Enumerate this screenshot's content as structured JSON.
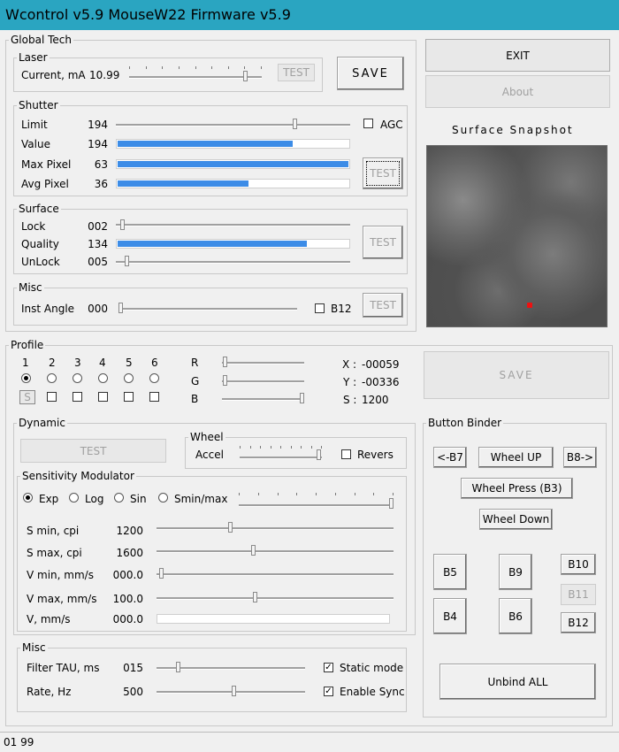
{
  "window": {
    "title": "Wcontrol v5.9  MouseW22  Firmware v5.9"
  },
  "global_tech": {
    "legend": "Global Tech",
    "laser": {
      "legend": "Laser",
      "label": "Current, mA",
      "value": "10.99",
      "test": "TEST"
    },
    "save": "SAVE",
    "shutter": {
      "legend": "Shutter",
      "rows": [
        {
          "label": "Limit",
          "value": "194"
        },
        {
          "label": "Value",
          "value": "194",
          "level": 0.76
        },
        {
          "label": "Max Pixel",
          "value": "63",
          "level": 1.0
        },
        {
          "label": "Avg Pixel",
          "value": "36",
          "level": 0.57
        }
      ],
      "agc": "AGC",
      "test": "TEST"
    },
    "surface": {
      "legend": "Surface",
      "rows": [
        {
          "label": "Lock",
          "value": "002"
        },
        {
          "label": "Quality",
          "value": "134",
          "level": 0.82
        },
        {
          "label": "UnLock",
          "value": "005"
        }
      ],
      "test": "TEST"
    },
    "misc": {
      "legend": "Misc",
      "label": "Inst Angle",
      "value": "000",
      "b12": "B12",
      "test": "TEST"
    }
  },
  "right": {
    "exit": "EXIT",
    "about": "About",
    "snapshot_title": "Surface Snapshot"
  },
  "profile": {
    "legend": "Profile",
    "numbers": [
      "1",
      "2",
      "3",
      "4",
      "5",
      "6"
    ],
    "s_button": "S",
    "rgb": [
      "R",
      "G",
      "B"
    ],
    "coords": {
      "x_label": "X :",
      "x": "-00059",
      "y_label": "Y :",
      "y": "-00336",
      "s_label": "S :",
      "s": "1200"
    },
    "save": "SAVE"
  },
  "dynamic": {
    "legend": "Dynamic",
    "test": "TEST",
    "wheel": {
      "legend": "Wheel",
      "accel": "Accel",
      "revers": "Revers"
    },
    "sensitivity": {
      "legend": "Sensitivity Modulator",
      "modes": [
        "Exp",
        "Log",
        "Sin",
        "Smin/max"
      ],
      "rows": [
        {
          "label": "S min, cpi",
          "value": "1200"
        },
        {
          "label": "S max, cpi",
          "value": "1600"
        },
        {
          "label": "V min, mm/s",
          "value": "000.0"
        },
        {
          "label": "V max, mm/s",
          "value": "100.0"
        },
        {
          "label": "V, mm/s",
          "value": "000.0"
        }
      ]
    },
    "misc": {
      "legend": "Misc",
      "rows": [
        {
          "label": "Filter TAU, ms",
          "value": "015",
          "check": "Static mode"
        },
        {
          "label": "Rate, Hz",
          "value": "500",
          "check": "Enable Sync"
        }
      ]
    }
  },
  "binder": {
    "legend": "Button Binder",
    "b7": "<-B7",
    "wheel_up": "Wheel UP",
    "b8": "B8->",
    "wheel_press": "Wheel Press (B3)",
    "wheel_down": "Wheel Down",
    "b5": "B5",
    "b9": "B9",
    "b10": "B10",
    "b11": "B11",
    "b4": "B4",
    "b6": "B6",
    "b12": "B12",
    "unbind": "Unbind ALL"
  },
  "status": {
    "text": "01 99"
  }
}
